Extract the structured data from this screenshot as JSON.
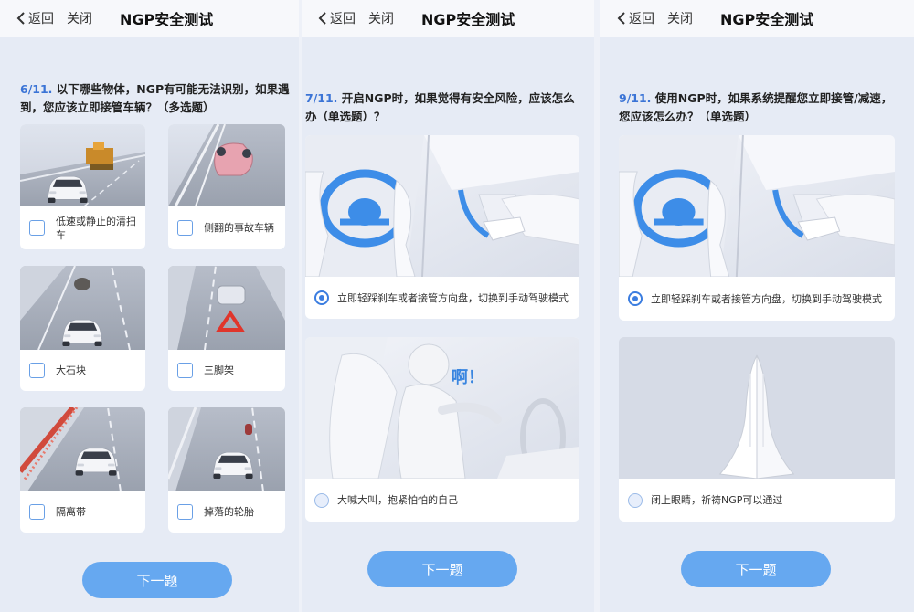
{
  "colors": {
    "accent": "#3b7de0",
    "button": "#66a8f0",
    "background": "#e6ebf5"
  },
  "screens": [
    {
      "back_label": "返回",
      "close_label": "关闭",
      "title": "NGP安全测试",
      "question_number": "6/11.",
      "question_text": "以下哪些物体，NGP有可能无法识别，如果遇到，您应该立即接管车辆？（多选题）",
      "options": [
        {
          "label": "低速或静止的清扫车",
          "image": "street-sweeper-image"
        },
        {
          "label": "侧翻的事故车辆",
          "image": "overturned-car-image"
        },
        {
          "label": "大石块",
          "image": "large-rock-image"
        },
        {
          "label": "三脚架",
          "image": "warning-triangle-image"
        },
        {
          "label": "隔离带",
          "image": "median-barrier-image"
        },
        {
          "label": "掉落的轮胎",
          "image": "fallen-tire-image"
        }
      ],
      "next_label": "下一题"
    },
    {
      "back_label": "返回",
      "close_label": "关闭",
      "title": "NGP安全测试",
      "question_number": "7/11.",
      "question_text": "开启NGP时，如果觉得有安全风险，应该怎么办（单选题）？",
      "options": [
        {
          "label": "立即轻踩刹车或者接管方向盘，切换到手动驾驶模式",
          "image": "steering-and-brake-image",
          "selected": true
        },
        {
          "label": "大喊大叫，抱紧怕怕的自己",
          "image": "scared-driver-image",
          "exclaim": "啊！",
          "selected": false
        }
      ],
      "next_label": "下一题"
    },
    {
      "back_label": "返回",
      "close_label": "关闭",
      "title": "NGP安全测试",
      "question_number": "9/11.",
      "question_text": "使用NGP时，如果系统提醒您立即接管/减速，您应该怎么办？（单选题）",
      "options": [
        {
          "label": "立即轻踩刹车或者接管方向盘，切换到手动驾驶模式",
          "image": "steering-and-brake-image",
          "selected": true
        },
        {
          "label": "闭上眼睛，祈祷NGP可以通过",
          "image": "praying-hands-image",
          "selected": false
        }
      ],
      "next_label": "下一题"
    }
  ]
}
